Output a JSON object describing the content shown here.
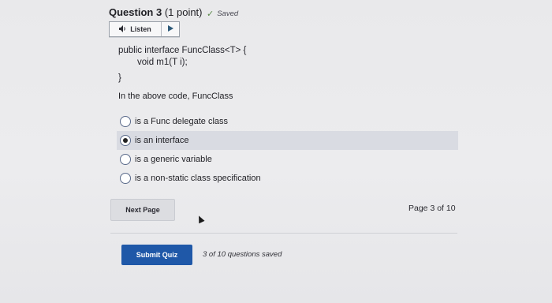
{
  "question": {
    "title": "Question 3",
    "points": "(1 point)",
    "saved_label": "Saved",
    "listen_label": "Listen"
  },
  "code": {
    "line1": "public interface FuncClass<T> {",
    "line2": "void m1(T i);",
    "line3": "}"
  },
  "prompt": "In the above code, FuncClass",
  "options": [
    {
      "label": "is a Func delegate class",
      "selected": false
    },
    {
      "label": "is an interface",
      "selected": true
    },
    {
      "label": "is a generic variable",
      "selected": false
    },
    {
      "label": "is a non-static class specification",
      "selected": false
    }
  ],
  "navigation": {
    "next_label": "Next Page",
    "page_info": "Page 3 of 10"
  },
  "footer": {
    "submit_label": "Submit Quiz",
    "saved_count": "3 of 10 questions saved"
  },
  "colors": {
    "submit_bg": "#1f58a8",
    "selected_row_bg": "#d9dbe2"
  },
  "icons": [
    "check-icon",
    "speaker-icon",
    "play-icon",
    "mouse-cursor-icon"
  ]
}
